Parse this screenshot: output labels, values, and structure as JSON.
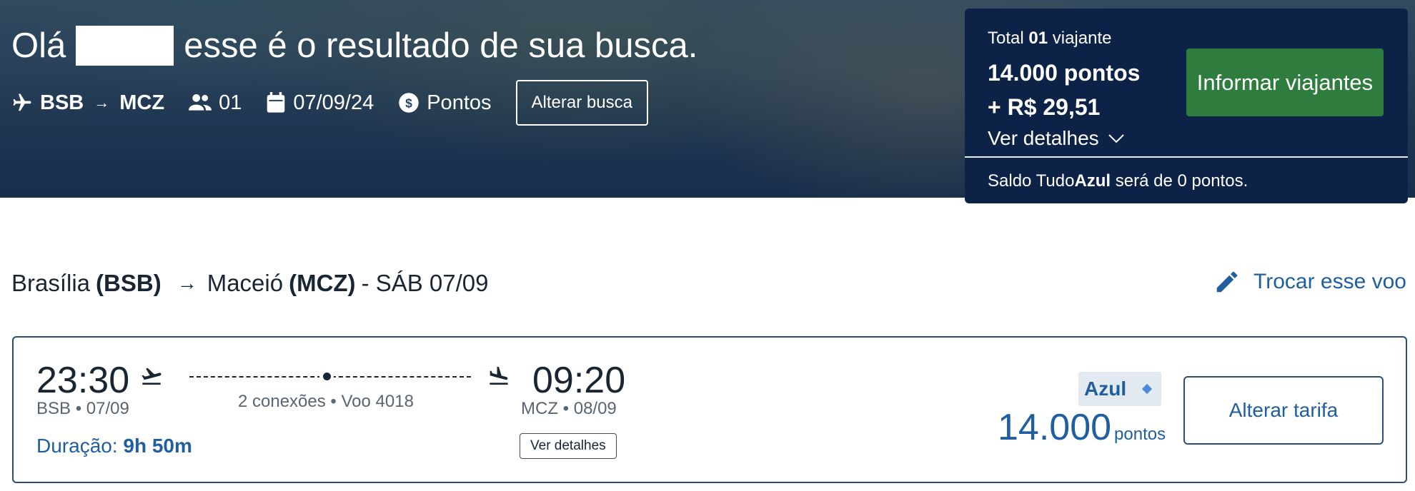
{
  "hero": {
    "greeting_prefix": "Olá",
    "greeting_suffix": "esse é o resultado de sua busca.",
    "origin": "BSB",
    "destination": "MCZ",
    "passengers": "01",
    "date": "07/09/24",
    "payment": "Pontos",
    "alter_search_label": "Alterar busca"
  },
  "summary": {
    "total_prefix": "Total",
    "total_count": "01",
    "total_suffix": "viajante",
    "points_line": "14.000 pontos",
    "cash_line": "+ R$ 29,51",
    "details_label": "Ver detalhes",
    "inform_button_label": "Informar viajantes",
    "saldo_prefix": "Saldo Tudo",
    "saldo_brand": "Azul",
    "saldo_suffix": "será de 0 pontos."
  },
  "route": {
    "origin_city": "Brasília",
    "origin_code": "(BSB)",
    "dest_city": "Maceió",
    "dest_code": "(MCZ)",
    "date_label": "- SÁB 07/09",
    "change_flight_label": "Trocar esse voo"
  },
  "flight": {
    "departure_time": "23:30",
    "departure_info": "BSB • 07/09",
    "connections": "2 conexões • Voo 4018",
    "arrival_time": "09:20",
    "arrival_info": "MCZ • 08/09",
    "duration_label": "Duração:",
    "duration_value": "9h 50m",
    "details_button": "Ver detalhes",
    "fare_badge": "Azul",
    "price_value": "14.000",
    "price_unit": "pontos",
    "change_fare_label": "Alterar tarifa"
  },
  "colors": {
    "navy": "#0c2247",
    "green_button": "#2e7d3e",
    "link_blue": "#1f5fa0",
    "card_border": "#2b4d77"
  }
}
